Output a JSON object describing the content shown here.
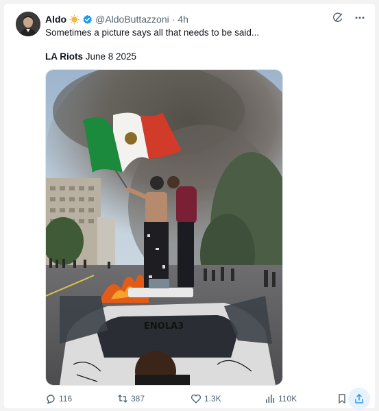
{
  "author": {
    "name": "Aldo",
    "handle": "@AldoButtazzoni",
    "separator": "·",
    "time": "4h"
  },
  "post": {
    "text": "Sometimes a picture says all that needs to be said...",
    "caption_bold": "LA Riots",
    "caption_rest": " June 8 2025",
    "image_spray_text": "ENOLA3"
  },
  "metrics": {
    "replies": "116",
    "reposts": "387",
    "likes": "1.3K",
    "views": "110K"
  },
  "colors": {
    "accent": "#1d9bf0",
    "muted": "#536471"
  },
  "icons": [
    "grok-icon",
    "more-icon",
    "verified-badge-icon",
    "reply-icon",
    "repost-icon",
    "like-icon",
    "views-icon",
    "bookmark-icon",
    "share-icon"
  ]
}
